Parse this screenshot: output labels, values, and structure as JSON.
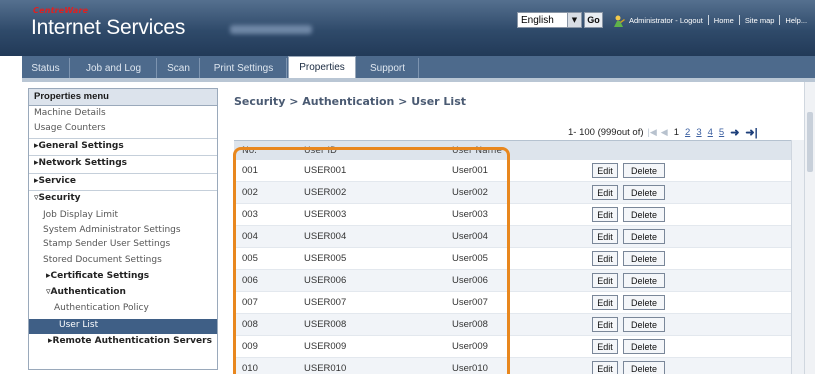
{
  "header": {
    "brand_small": "CentreWare",
    "brand_title": "Internet Services",
    "language": {
      "selected": "English"
    },
    "go_label": "Go",
    "links": [
      "Administrator - Logout",
      "Home",
      "Site map",
      "Help..."
    ],
    "admin_icon": "administrator-icon"
  },
  "tabs": [
    {
      "label": "Status",
      "active": false
    },
    {
      "label": "Job and Log",
      "active": false
    },
    {
      "label": "Scan",
      "active": false
    },
    {
      "label": "Print Settings",
      "active": false
    },
    {
      "label": "Properties",
      "active": true
    },
    {
      "label": "Support",
      "active": false
    }
  ],
  "menu": {
    "title": "Properties menu",
    "items": [
      {
        "label": "Machine Details"
      },
      {
        "label": "Usage Counters"
      },
      {
        "label": "▸General Settings"
      },
      {
        "label": "▸Network Settings"
      },
      {
        "label": "▸Service"
      },
      {
        "label": "▿Security"
      },
      {
        "label": "Job Display Limit"
      },
      {
        "label": "System Administrator Settings"
      },
      {
        "label": "Stamp Sender User Settings"
      },
      {
        "label": "Stored Document Settings"
      },
      {
        "label": "▸Certificate Settings"
      },
      {
        "label": "▿Authentication"
      },
      {
        "label": "Authentication Policy"
      },
      {
        "label": "User List",
        "selected": true
      },
      {
        "label": "▸Remote Authentication Servers"
      }
    ]
  },
  "breadcrumb": "Security > Authentication > User List",
  "pager": {
    "range": "1- 100 (999out of)",
    "current": "1",
    "pages": [
      "2",
      "3",
      "4",
      "5"
    ]
  },
  "table": {
    "columns": [
      "No.",
      "User ID",
      "User Name"
    ],
    "edit_label": "Edit",
    "delete_label": "Delete",
    "rows": [
      {
        "no": "001",
        "user_id": "USER001",
        "user_name": "User001"
      },
      {
        "no": "002",
        "user_id": "USER002",
        "user_name": "User002"
      },
      {
        "no": "003",
        "user_id": "USER003",
        "user_name": "User003"
      },
      {
        "no": "004",
        "user_id": "USER004",
        "user_name": "User004"
      },
      {
        "no": "005",
        "user_id": "USER005",
        "user_name": "User005"
      },
      {
        "no": "006",
        "user_id": "USER006",
        "user_name": "User006"
      },
      {
        "no": "007",
        "user_id": "USER007",
        "user_name": "User007"
      },
      {
        "no": "008",
        "user_id": "USER008",
        "user_name": "User008"
      },
      {
        "no": "009",
        "user_id": "USER009",
        "user_name": "User009"
      },
      {
        "no": "010",
        "user_id": "USER010",
        "user_name": "User010"
      }
    ]
  },
  "colors": {
    "header": "#2f4a6a",
    "tabbar": "#4d6a8c",
    "selected_item": "#3f5f86",
    "highlight": "#e8871e",
    "brand_red": "#e02020"
  }
}
